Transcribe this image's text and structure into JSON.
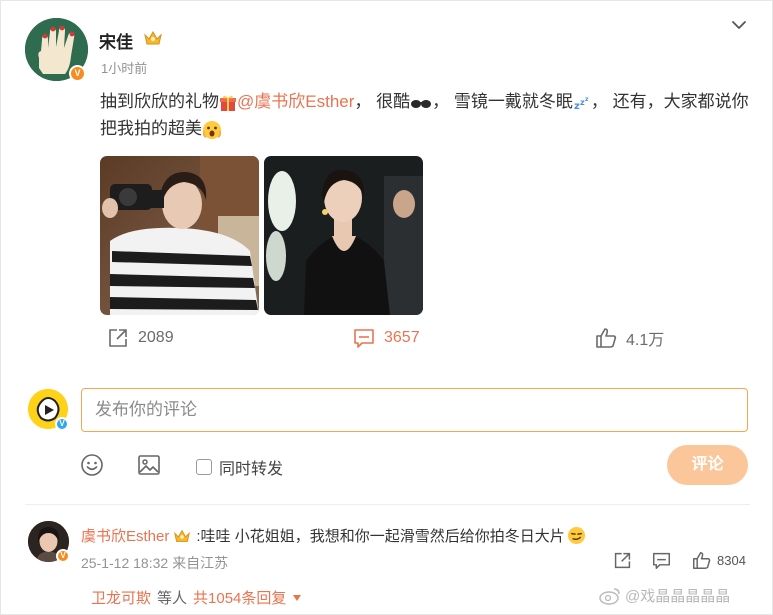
{
  "post": {
    "author": "宋佳",
    "time": "1小时前",
    "text_before": "抽到欣欣的礼物",
    "mention": "@虞书欣Esther",
    "text_mid1": "， 很酷",
    "text_mid2": "， 雪镜一戴就冬眠",
    "text_mid3": "， 还有，大家都说你把我拍的超美",
    "stats": {
      "reposts": "2089",
      "comments": "3657",
      "likes": "4.1万"
    }
  },
  "composer": {
    "placeholder": "发布你的评论",
    "repost_label": "同时转发",
    "submit_label": "评论"
  },
  "comment": {
    "user": "虞书欣Esther",
    "text": ":哇哇 小花姐姐，我想和你一起滑雪然后给你拍冬日大片",
    "meta": "25-1-12 18:32 来自江苏",
    "likes": "8304",
    "reply_user": "卫龙可欺",
    "reply_mid": "等人",
    "reply_total": "共1054条回复"
  },
  "watermark": "@戏晶晶晶晶晶",
  "colors": {
    "accent": "#eb7350",
    "input_border": "#f2a94c",
    "submit_bg": "#fbc79a",
    "verified_orange": "#f78b1f",
    "verified_blue": "#2fa9e8"
  }
}
